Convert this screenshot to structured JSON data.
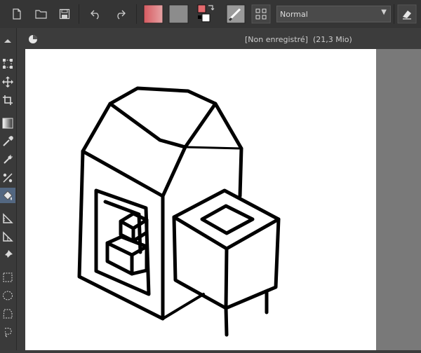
{
  "toolbar": {
    "blend_mode": "Normal",
    "buttons": [
      {
        "name": "new-document-icon"
      },
      {
        "name": "open-document-icon"
      },
      {
        "name": "save-icon"
      },
      {
        "name": "undo-icon"
      },
      {
        "name": "redo-icon"
      },
      {
        "name": "gradient-fill-icon"
      },
      {
        "name": "pattern-fill-icon"
      },
      {
        "name": "color-swap-icon"
      },
      {
        "name": "brush-presets-icon"
      },
      {
        "name": "workspace-grid-icon"
      },
      {
        "name": "eraser-mode-icon"
      }
    ],
    "colors": {
      "foreground": "#e46a6e",
      "background": "#ffffff"
    }
  },
  "document": {
    "status": "[Non enregistré]",
    "size": "(21,3 Mio)",
    "tab_icon": "krita-document-icon"
  },
  "left_tools": [
    "scroll-up-arrow-icon",
    "transform-icon",
    "move-icon",
    "crop-icon",
    "gradient-icon",
    "color-picker-icon",
    "smart-patch-icon",
    "multibrush-icon",
    "fill-icon",
    "ruler-icon",
    "perspective-icon",
    "reference-pin-icon",
    "rectangle-select-icon",
    "ellipse-select-icon",
    "polygon-select-icon",
    "freehand-select-icon"
  ],
  "active_tool": "fill-icon",
  "colors": {
    "toolbar_bg": "#353535",
    "panel_bg": "#3a3a3a",
    "canvas_bg": "#797979",
    "paper": "#ffffff",
    "active_highlight": "#536781"
  }
}
